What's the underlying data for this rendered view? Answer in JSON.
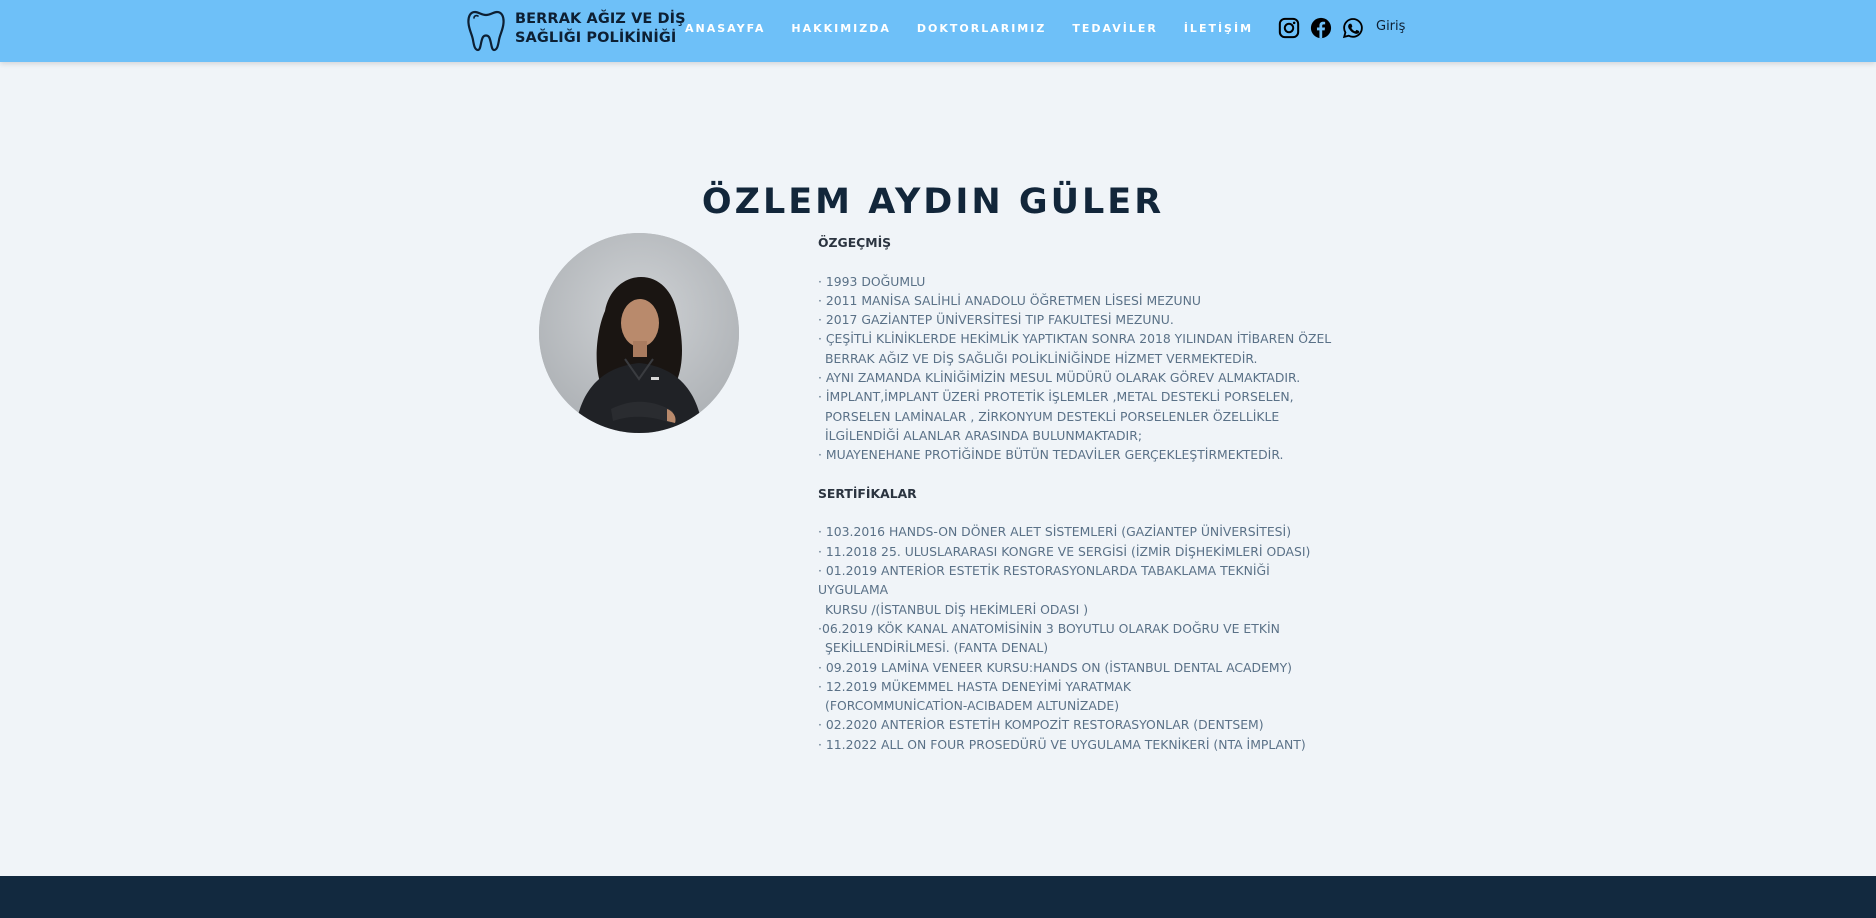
{
  "header": {
    "brand_line1": "BERRAK AĞIZ VE DİŞ",
    "brand_line2": "SAĞLIĞI POLİKİNİĞİ",
    "nav": [
      "ANASAYFA",
      "HAKKIMIZDA",
      "DOKTORLARIMIZ",
      "TEDAVİLER",
      "İLETİŞİM"
    ],
    "social_icons": [
      "instagram-icon",
      "facebook-icon",
      "whatsapp-icon"
    ],
    "login_label": "Giriş",
    "colors": {
      "bar": "#6ec0f8",
      "nav_text": "#ffffff"
    }
  },
  "profile": {
    "name": "ÖZLEM AYDIN GÜLER",
    "cv_title": "ÖZGEÇMİŞ",
    "cv_items": [
      [
        "· 1993 DOĞUMLU"
      ],
      [
        "· 2011 MANİSA SALİHLİ ANADOLU ÖĞRETMEN LİSESİ MEZUNU"
      ],
      [
        "· 2017 GAZİANTEP ÜNİVERSİTESİ TIP FAKULTESİ MEZUNU."
      ],
      [
        "· ÇEŞİTLİ KLİNİKLERDE HEKİMLİK YAPTIKTAN SONRA 2018 YILINDAN İTİBAREN ÖZEL",
        "BERRAK AĞIZ VE DİŞ SAĞLIĞI POLİKLİNİĞİNDE HİZMET VERMEKTEDİR."
      ],
      [
        "· AYNI ZAMANDA KLİNİĞİMİZİN MESUL MÜDÜRÜ OLARAK GÖREV ALMAKTADIR."
      ],
      [
        "· İMPLANT,İMPLANT ÜZERİ PROTETİK İŞLEMLER ,METAL DESTEKLİ PORSELEN,",
        "PORSELEN LAMİNALAR , ZİRKONYUM DESTEKLİ PORSELENLER ÖZELLİKLE",
        "İLGİLENDİĞİ ALANLAR ARASINDA BULUNMAKTADIR;"
      ],
      [
        "· MUAYENEHANE PROTİĞİNDE BÜTÜN TEDAVİLER GERÇEKLEŞTİRMEKTEDİR."
      ]
    ],
    "cert_title": "SERTİFİKALAR",
    "cert_items": [
      [
        "· 103.2016 HANDS-ON DÖNER ALET SİSTEMLERİ (GAZİANTEP ÜNİVERSİTESİ)"
      ],
      [
        "· 11.2018 25. ULUSLARARASI KONGRE VE SERGİSİ (İZMİR DİŞHEKİMLERİ ODASI)"
      ],
      [
        "· 01.2019 ANTERİOR ESTETİK RESTORASYONLARDA TABAKLAMA TEKNİĞİ UYGULAMA",
        "KURSU /(İSTANBUL DİŞ HEKİMLERİ ODASI )"
      ],
      [
        "·06.2019 KÖK KANAL ANATOMİSİNİN 3 BOYUTLU OLARAK DOĞRU VE ETKİN",
        "ŞEKİLLENDİRİLMESİ. (FANTA DENAL)"
      ],
      [
        "· 09.2019 LAMİNA VENEER KURSU:HANDS ON (İSTANBUL DENTAL ACADEMY)"
      ],
      [
        "· 12.2019 MÜKEMMEL HASTA DENEYİMİ YARATMAK",
        "(FORCOMMUNİCATİON-ACIBADEM ALTUNİZADE)"
      ],
      [
        "· 02.2020 ANTERİOR ESTETİH KOMPOZİT RESTORASYONLAR (DENTSEM)"
      ],
      [
        "· 11.2022 ALL ON FOUR PROSEDÜRÜ VE UYGULAMA TEKNİKERİ (NTA İMPLANT)"
      ]
    ]
  }
}
